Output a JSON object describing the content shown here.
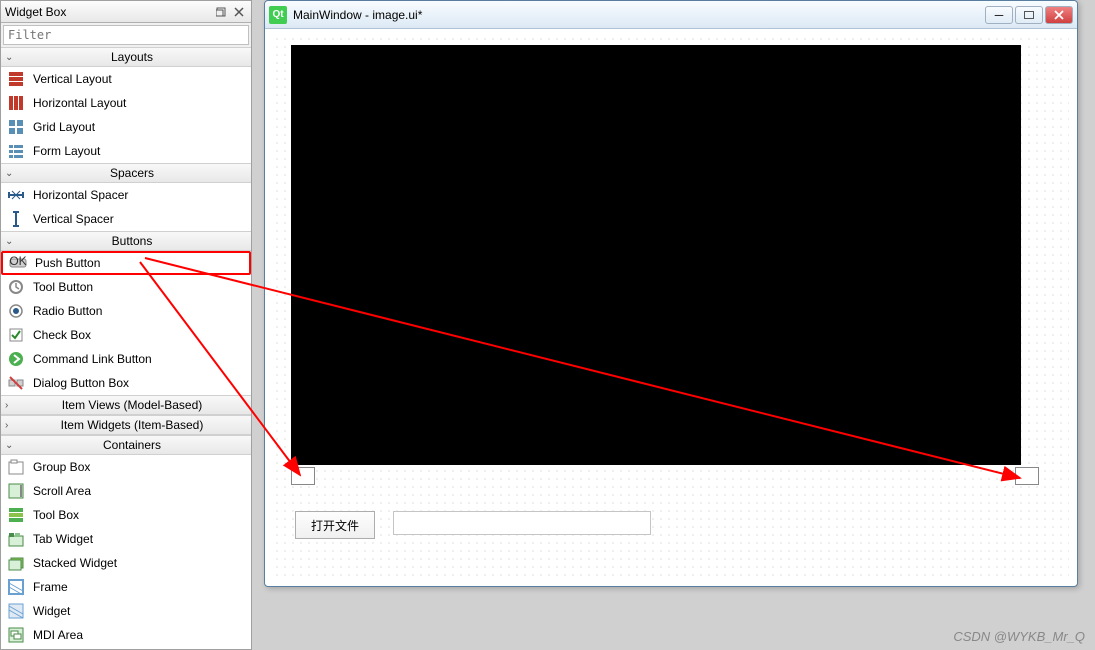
{
  "widgetBox": {
    "title": "Widget Box",
    "filterPlaceholder": "Filter",
    "groups": [
      {
        "id": "layouts",
        "label": "Layouts",
        "expanded": true,
        "items": [
          {
            "icon": "vlayout",
            "label": "Vertical Layout"
          },
          {
            "icon": "hlayout",
            "label": "Horizontal Layout"
          },
          {
            "icon": "grid",
            "label": "Grid Layout"
          },
          {
            "icon": "form",
            "label": "Form Layout"
          }
        ]
      },
      {
        "id": "spacers",
        "label": "Spacers",
        "expanded": true,
        "items": [
          {
            "icon": "hspacer",
            "label": "Horizontal Spacer"
          },
          {
            "icon": "vspacer",
            "label": "Vertical Spacer"
          }
        ]
      },
      {
        "id": "buttons",
        "label": "Buttons",
        "expanded": true,
        "items": [
          {
            "icon": "pushbtn",
            "label": "Push Button",
            "highlighted": true
          },
          {
            "icon": "toolbtn",
            "label": "Tool Button"
          },
          {
            "icon": "radio",
            "label": "Radio Button"
          },
          {
            "icon": "check",
            "label": "Check Box"
          },
          {
            "icon": "cmdlink",
            "label": "Command Link Button"
          },
          {
            "icon": "dlgbox",
            "label": "Dialog Button Box"
          }
        ]
      },
      {
        "id": "itemviews",
        "label": "Item Views (Model-Based)",
        "expanded": false,
        "items": []
      },
      {
        "id": "itemwidgets",
        "label": "Item Widgets (Item-Based)",
        "expanded": false,
        "items": []
      },
      {
        "id": "containers",
        "label": "Containers",
        "expanded": true,
        "items": [
          {
            "icon": "groupbox",
            "label": "Group Box"
          },
          {
            "icon": "scrollarea",
            "label": "Scroll Area"
          },
          {
            "icon": "toolbox",
            "label": "Tool Box"
          },
          {
            "icon": "tabwidget",
            "label": "Tab Widget"
          },
          {
            "icon": "stacked",
            "label": "Stacked Widget"
          },
          {
            "icon": "frame",
            "label": "Frame"
          },
          {
            "icon": "widget",
            "label": "Widget"
          },
          {
            "icon": "mdi",
            "label": "MDI Area"
          }
        ]
      }
    ]
  },
  "designWindow": {
    "title": "MainWindow - image.ui*",
    "openButtonLabel": "打开文件"
  },
  "watermark": "CSDN @WYKB_Mr_Q"
}
